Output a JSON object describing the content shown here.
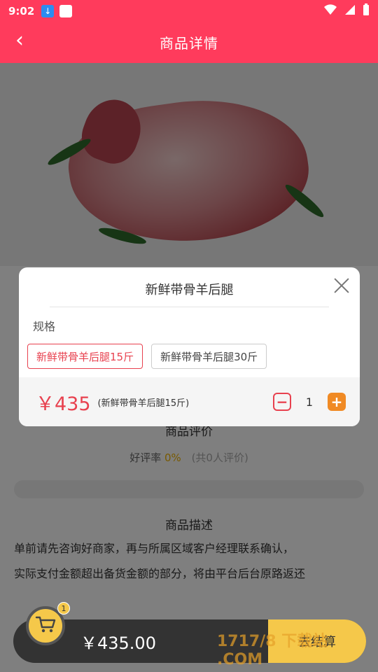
{
  "status_bar": {
    "time": "9:02"
  },
  "header": {
    "back_glyph": "‹",
    "title": "商品详情"
  },
  "page": {
    "section_reviews_title": "商品评价",
    "good_rate_label": "好评率",
    "good_rate_value": "0%",
    "review_count": "(共0人评价)",
    "section_desc_title": "商品描述",
    "desc_line1": "单前请先咨询好商家，再与所属区域客户经理联系确认，",
    "desc_line2": "实际支付金额超出备货金额的部分，将由平台后台原路返还"
  },
  "dialog": {
    "title": "新鲜带骨羊后腿",
    "spec_label": "规格",
    "options": [
      {
        "label": "新鲜带骨羊后腿15斤",
        "selected": true
      },
      {
        "label": "新鲜带骨羊后腿30斤",
        "selected": false
      }
    ],
    "price": "￥435",
    "price_note": "(新鲜带骨羊后腿15斤)",
    "quantity": "1",
    "minus_glyph": "−",
    "plus_glyph": "+"
  },
  "cart": {
    "badge_count": "1",
    "total": "￥435.00",
    "checkout_label": "去结算"
  },
  "watermark": "1717/8 下载站 .COM",
  "colors": {
    "brand": "#ff3b5c",
    "accent_red": "#e8414f",
    "accent_orange": "#f08a24",
    "cart_yellow": "#f5c84a"
  }
}
